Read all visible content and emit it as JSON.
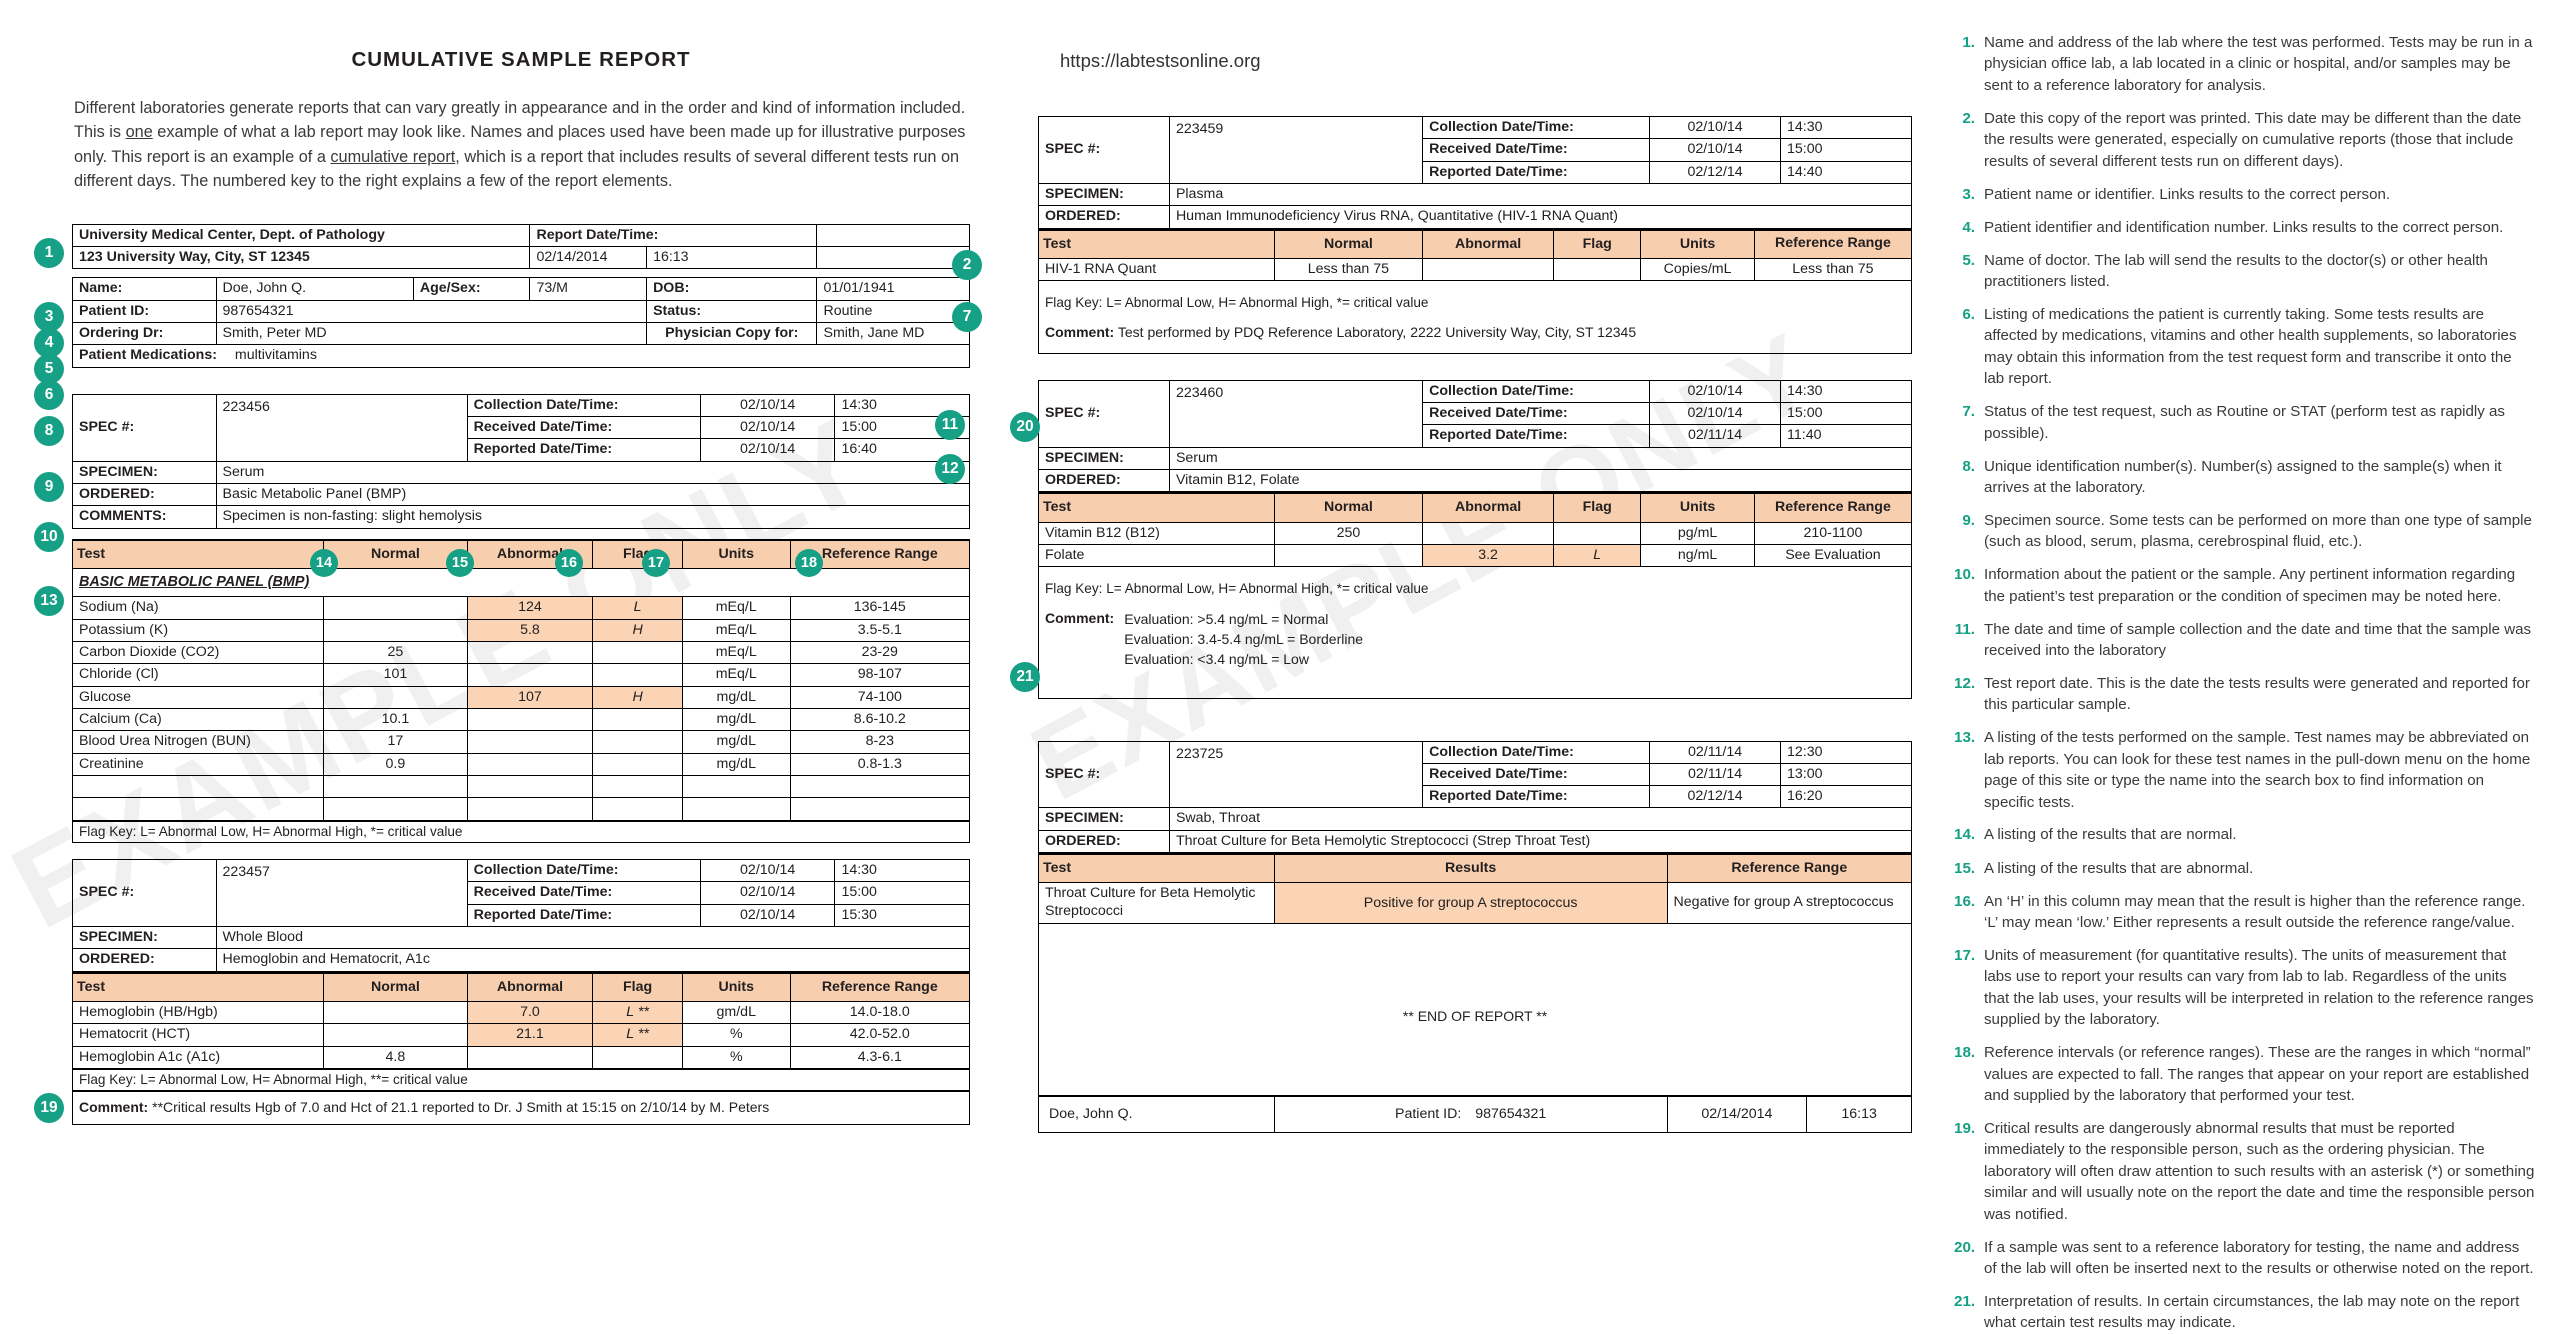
{
  "watermark": {
    "left": "EXAMPLE ONLY",
    "right": "EXAMPLE ONLY"
  },
  "intro": {
    "title": "CUMULATIVE SAMPLE REPORT",
    "body_1": "Different laboratories generate reports that can vary greatly in appearance and in the order and kind of information included. This is ",
    "body_u1": "one",
    "body_2": " example of what a lab report may look like. Names and places used have been made up for illustrative purposes only. This report is an example of a ",
    "body_u2": "cumulative report",
    "body_3": ", which is a report that includes results of several different tests run on different days. The numbered key to the right explains a few of the report elements."
  },
  "url": "https://labtestsonline.org",
  "header": {
    "lab_name": "University Medical Center, Dept. of Pathology",
    "lab_address": "123 University Way, City, ST 12345",
    "report_datetime_label": "Report Date/Time:",
    "report_date": "02/14/2014",
    "report_time": "16:13",
    "name_label": "Name:",
    "name_value": "Doe, John Q.",
    "agesex_label": "Age/Sex:",
    "agesex_value": "73/M",
    "dob_label": "DOB:",
    "dob_value": "01/01/1941",
    "patient_id_label": "Patient ID:",
    "patient_id_value": "987654321",
    "status_label": "Status:",
    "status_value": "Routine",
    "ordering_dr_label": "Ordering Dr:",
    "ordering_dr_value": "Smith, Peter MD",
    "physician_copy_label": "Physician Copy for:",
    "physician_copy_value": "Smith, Jane MD",
    "medications_label": "Patient Medications:",
    "medications_value": "multivitamins"
  },
  "labels": {
    "spec": "SPEC #:",
    "specimen": "SPECIMEN:",
    "ordered": "ORDERED:",
    "comments": "COMMENTS:",
    "comment": "Comment:",
    "collection": "Collection Date/Time:",
    "received": "Received Date/Time:",
    "reported": "Reported Date/Time:",
    "flag_key_single": "Flag Key: L= Abnormal Low, H= Abnormal High, *= critical value",
    "flag_key_double": "Flag Key: L= Abnormal Low, H= Abnormal High, **= critical value",
    "end_of_report": "** END OF REPORT **",
    "footer_patient_id": "Patient ID:"
  },
  "columns": {
    "test": "Test",
    "normal": "Normal",
    "abnormal": "Abnormal",
    "flag": "Flag",
    "units": "Units",
    "reference_range": "Reference Range",
    "reference_range_2line": "Reference Range",
    "results": "Results"
  },
  "specimens": [
    {
      "id": "bmp",
      "spec_number": "223456",
      "collection_date": "02/10/14",
      "collection_time": "14:30",
      "received_date": "02/10/14",
      "received_time": "15:00",
      "reported_date": "02/10/14",
      "reported_time": "16:40",
      "specimen": "Serum",
      "ordered": "Basic Metabolic Panel (BMP)",
      "comments": "Specimen is non-fasting: slight hemolysis",
      "panel_title": "BASIC METABOLIC PANEL (BMP)",
      "rows": [
        {
          "test": "Sodium (Na)",
          "normal": "",
          "abnormal": "124",
          "flag": "L",
          "units": "mEq/L",
          "range": "136-145"
        },
        {
          "test": "Potassium (K)",
          "normal": "",
          "abnormal": "5.8",
          "flag": "H",
          "units": "mEq/L",
          "range": "3.5-5.1"
        },
        {
          "test": "Carbon Dioxide (CO2)",
          "normal": "25",
          "abnormal": "",
          "flag": "",
          "units": "mEq/L",
          "range": "23-29"
        },
        {
          "test": "Chloride (Cl)",
          "normal": "101",
          "abnormal": "",
          "flag": "",
          "units": "mEq/L",
          "range": "98-107"
        },
        {
          "test": "Glucose",
          "normal": "",
          "abnormal": "107",
          "flag": "H",
          "units": "mg/dL",
          "range": "74-100"
        },
        {
          "test": "Calcium (Ca)",
          "normal": "10.1",
          "abnormal": "",
          "flag": "",
          "units": "mg/dL",
          "range": "8.6-10.2"
        },
        {
          "test": "Blood Urea Nitrogen (BUN)",
          "normal": "17",
          "abnormal": "",
          "flag": "",
          "units": "mg/dL",
          "range": "8-23"
        },
        {
          "test": "Creatinine",
          "normal": "0.9",
          "abnormal": "",
          "flag": "",
          "units": "mg/dL",
          "range": "0.8-1.3"
        },
        {
          "test": "",
          "normal": "",
          "abnormal": "",
          "flag": "",
          "units": "",
          "range": ""
        },
        {
          "test": "",
          "normal": "",
          "abnormal": "",
          "flag": "",
          "units": "",
          "range": ""
        }
      ]
    },
    {
      "id": "hgb",
      "spec_number": "223457",
      "collection_date": "02/10/14",
      "collection_time": "14:30",
      "received_date": "02/10/14",
      "received_time": "15:00",
      "reported_date": "02/10/14",
      "reported_time": "15:30",
      "specimen": "Whole Blood",
      "ordered": "Hemoglobin and Hematocrit, A1c",
      "rows": [
        {
          "test": "Hemoglobin (HB/Hgb)",
          "normal": "",
          "abnormal": "7.0",
          "flag": "L **",
          "units": "gm/dL",
          "range": "14.0-18.0"
        },
        {
          "test": "Hematocrit (HCT)",
          "normal": "",
          "abnormal": "21.1",
          "flag": "L **",
          "units": "%",
          "range": "42.0-52.0"
        },
        {
          "test": "Hemoglobin A1c (A1c)",
          "normal": "4.8",
          "abnormal": "",
          "flag": "",
          "units": "%",
          "range": "4.3-6.1"
        }
      ],
      "comment": "**Critical results Hgb of 7.0 and Hct of 21.1 reported to Dr. J Smith at 15:15 on 2/10/14 by M. Peters"
    },
    {
      "id": "hiv",
      "spec_number": "223459",
      "collection_date": "02/10/14",
      "collection_time": "14:30",
      "received_date": "02/10/14",
      "received_time": "15:00",
      "reported_date": "02/12/14",
      "reported_time": "14:40",
      "specimen": "Plasma",
      "ordered": "Human Immunodeficiency Virus RNA, Quantitative (HIV-1 RNA Quant)",
      "rows": [
        {
          "test": "HIV-1 RNA Quant",
          "normal": "Less than 75",
          "abnormal": "",
          "flag": "",
          "units": "Copies/mL",
          "range": "Less than 75"
        }
      ],
      "comment": "Test performed by PDQ Reference Laboratory, 2222 University Way, City, ST 12345"
    },
    {
      "id": "b12",
      "spec_number": "223460",
      "collection_date": "02/10/14",
      "collection_time": "14:30",
      "received_date": "02/10/14",
      "received_time": "15:00",
      "reported_date": "02/11/14",
      "reported_time": "11:40",
      "specimen": "Serum",
      "ordered": "Vitamin B12, Folate",
      "rows": [
        {
          "test": "Vitamin B12 (B12)",
          "normal": "250",
          "abnormal": "",
          "flag": "",
          "units": "pg/mL",
          "range": "210-1100"
        },
        {
          "test": "Folate",
          "normal": "",
          "abnormal": "3.2",
          "flag": "L",
          "units": "ng/mL",
          "range": "See Evaluation"
        }
      ],
      "comment_lines": [
        "Evaluation: >5.4 ng/mL = Normal",
        "Evaluation: 3.4-5.4 ng/mL = Borderline",
        "Evaluation: <3.4 ng/mL = Low"
      ]
    },
    {
      "id": "strep",
      "spec_number": "223725",
      "collection_date": "02/11/14",
      "collection_time": "12:30",
      "received_date": "02/11/14",
      "received_time": "13:00",
      "reported_date": "02/12/14",
      "reported_time": "16:20",
      "specimen": "Swab, Throat",
      "ordered": "Throat Culture for Beta Hemolytic Streptococci (Strep Throat Test)",
      "culture_test": "Throat Culture for Beta Hemolytic Streptococci",
      "culture_result": "Positive for group A streptococcus",
      "culture_range": "Negative for group A streptococcus"
    }
  ],
  "footer": {
    "patient_name": "Doe, John Q.",
    "patient_id_label": "Patient ID:",
    "patient_id": "987654321",
    "date": "02/14/2014",
    "time": "16:13"
  },
  "key_items": [
    {
      "num": "1.",
      "text": "Name and address of the lab where the test was performed. Tests may be run in a physician office lab, a lab located in a clinic or hospital, and/or samples may be sent to a reference laboratory for analysis."
    },
    {
      "num": "2.",
      "text": "Date this copy of the report was printed. This date may be different than the date the results were generated, especially on cumulative reports (those that include results of several different tests run on different days)."
    },
    {
      "num": "3.",
      "text": "Patient name or identifier. Links results to the correct person."
    },
    {
      "num": "4.",
      "text": "Patient identifier and identification number. Links results to the correct person."
    },
    {
      "num": "5.",
      "text": "Name of doctor. The lab will send the results to the doctor(s) or other health practitioners listed."
    },
    {
      "num": "6.",
      "text": "Listing of medications the patient is currently taking. Some tests results are affected by medications, vitamins and other health supplements, so laboratories may obtain this information from the test request form and transcribe it onto the lab report."
    },
    {
      "num": "7.",
      "text": "Status of the test request, such as Routine or STAT (perform test as rapidly as possible)."
    },
    {
      "num": "8.",
      "text": "Unique identification number(s). Number(s) assigned to the sample(s) when it arrives at the laboratory."
    },
    {
      "num": "9.",
      "text": "Specimen source. Some tests can be performed on more than one type of sample (such as blood, serum, plasma, cerebrospinal fluid, etc.)."
    },
    {
      "num": "10.",
      "text": "Information about the patient or the sample. Any pertinent information regarding the patient’s test preparation or the condition of specimen may be noted here."
    },
    {
      "num": "11.",
      "text": "The date and time of sample collection and the date and time that the sample was received into the laboratory"
    },
    {
      "num": "12.",
      "text": "Test report date. This is the date the tests results were generated and reported for this particular sample."
    },
    {
      "num": "13.",
      "text": "A listing of the tests performed on the sample. Test names may be abbreviated on lab reports. You can look for these test names in the pull-down menu on the home page of this site or type the name into the search box to find information on specific tests."
    },
    {
      "num": "14.",
      "text": "A listing of the results that are normal."
    },
    {
      "num": "15.",
      "text": "A listing of the results that are abnormal."
    },
    {
      "num": "16.",
      "text": "An ‘H’ in this column may mean that the result is higher than the reference range. ‘L’ may mean ‘low.’ Either represents a result outside the reference range/value."
    },
    {
      "num": "17.",
      "text": "Units of measurement (for quantitative results). The units of measurement that labs use to report your results can vary from lab to lab. Regardless of the units that the lab uses, your results will be interpreted in relation to the reference ranges supplied by the laboratory."
    },
    {
      "num": "18.",
      "text": "Reference intervals (or reference ranges). These are the ranges in which “normal” values are expected to fall. The ranges that appear on your report are established and supplied by the laboratory that performed your test."
    },
    {
      "num": "19.",
      "text": "Critical results are dangerously abnormal results that must be reported immediately to the responsible person, such as the ordering physician. The laboratory will often draw attention to such results with an asterisk (*) or something similar and will usually note on the report the date and time the responsible person was notified."
    },
    {
      "num": "20.",
      "text": "If a sample was sent to a reference laboratory for testing, the name and address of the lab will often be inserted next to the results or otherwise noted on the report."
    },
    {
      "num": "21.",
      "text": "Interpretation of results. In certain circumstances, the lab may note on the report what certain test results may indicate."
    }
  ],
  "callouts": [
    "1",
    "2",
    "3",
    "4",
    "5",
    "6",
    "7",
    "8",
    "9",
    "10",
    "11",
    "12",
    "13",
    "14",
    "15",
    "16",
    "17",
    "18",
    "19",
    "20",
    "21"
  ],
  "colors": {
    "accent": "#16a085",
    "header_band": "#f7cfae",
    "abnormal_cell": "#fad4b4"
  }
}
